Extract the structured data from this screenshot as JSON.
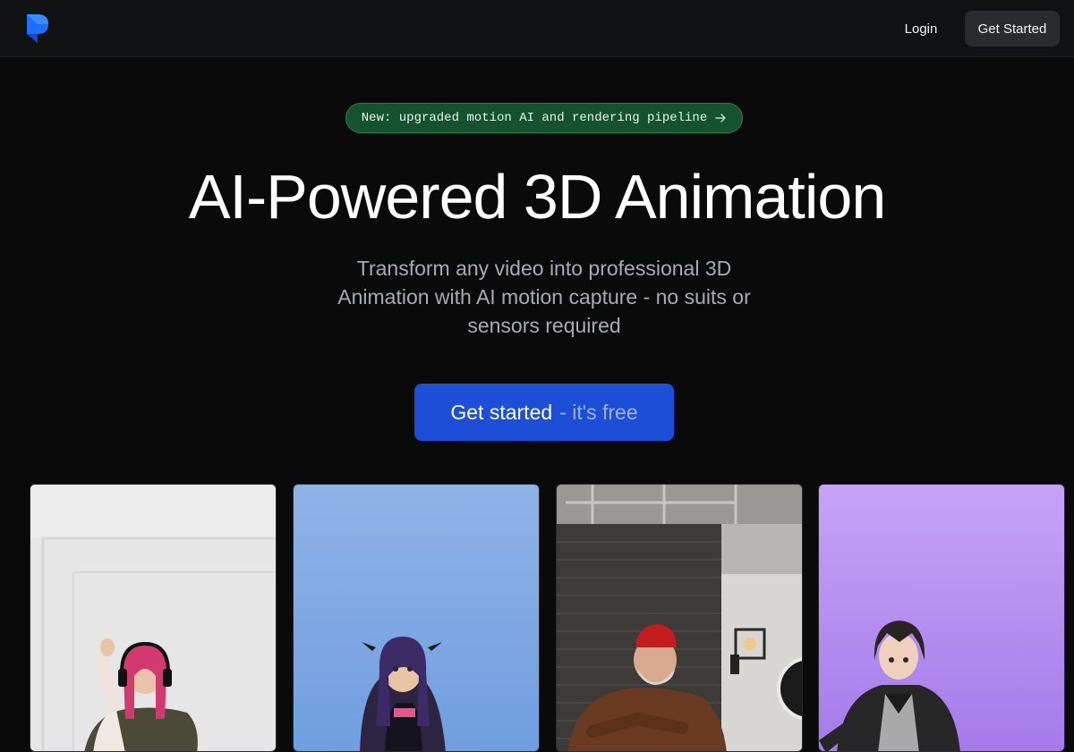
{
  "nav": {
    "login": "Login",
    "get_started": "Get Started"
  },
  "announcement": {
    "text": "New: upgraded motion AI and rendering pipeline"
  },
  "hero": {
    "title": "AI-Powered 3D Animation",
    "subtitle": "Transform any video into professional 3D Animation with AI motion capture - no suits or sensors required",
    "cta_main": "Get started",
    "cta_muted": "- it's free"
  },
  "colors": {
    "brand": "#1d4ed8",
    "announce_bg": "#14532d",
    "background": "#0a0a0b"
  },
  "icons": [
    "logo-icon",
    "arrow-right-icon"
  ]
}
